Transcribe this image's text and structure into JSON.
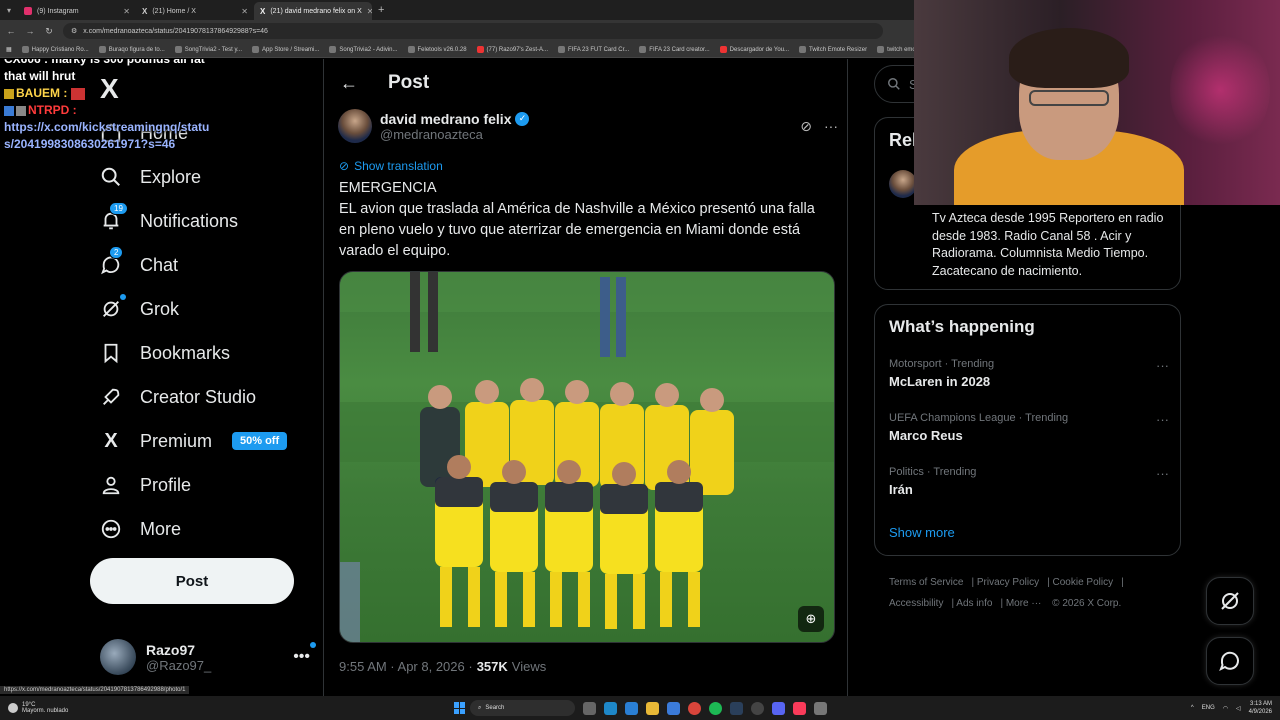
{
  "browser": {
    "tabs": [
      {
        "title": "(9) Instagram",
        "active": false,
        "color": "#e1306c"
      },
      {
        "title": "(21) Home / X",
        "active": false,
        "color": "#ffffff"
      },
      {
        "title": "(21) david medrano felix on X",
        "active": true,
        "color": "#ffffff"
      }
    ],
    "url": "x.com/medranoazteca/status/2041907813786492988?s=46",
    "bookmarks": [
      "Happy Cristiano Ro...",
      "Buraqo figura de to...",
      "SongTrivia2 - Test y...",
      "App Store / Streami...",
      "SongTrivia2 - Adivin...",
      "Feletools v26.0.28",
      "(77) Razo97's Zest-A...",
      "FIFA 23 FUT Card Cr...",
      "FIFA 23 Card creator...",
      "Descargador de You...",
      "Twitch Emote Resizer",
      "twitch emote re..."
    ]
  },
  "chat_overlay": {
    "line1": "CX606 : marky is 300 pounds all fat",
    "line2": "that will hrut",
    "user2": "BAUEM :",
    "user3": "NTRPD :",
    "link": "https://x.com/kickstreamingnq/status/2041998308630261971?s=46"
  },
  "sidebar": {
    "logo": "X",
    "nav": {
      "home": "Home",
      "explore": "Explore",
      "notifications": "Notifications",
      "notifications_badge": "19",
      "chat": "Chat",
      "chat_badge": "2",
      "grok": "Grok",
      "bookmarks": "Bookmarks",
      "creator_studio": "Creator Studio",
      "premium": "Premium",
      "premium_promo": "50% off",
      "profile": "Profile",
      "more": "More"
    },
    "post_button": "Post",
    "account": {
      "name": "Razo97",
      "handle": "@Razo97_",
      "more": "•••"
    }
  },
  "main": {
    "header_title": "Post",
    "author": {
      "name": "david medrano felix",
      "handle": "@medranoazteca"
    },
    "show_translation": "Show translation",
    "text_title": "EMERGENCIA",
    "text_body": "EL avion que traslada al América de Nashville a México presentó una falla en pleno vuelo y tuvo que aterrizar de emergencia en Miami donde está varado el equipo.",
    "time": "9:55 AM · Apr 8, 2026 ·",
    "views_count": "357K",
    "views_label": "Views"
  },
  "right": {
    "search_placeholder": "Se",
    "relevant_title": "Rel",
    "relevant_bio": "Tv Azteca desde 1995 Reportero en radio desde 1983. Radio Canal 58 . Acir y Radiorama. Columnista Medio Tiempo. Zacatecano de nacimiento.",
    "happening_title": "What’s happening",
    "trends": [
      {
        "context": "Motorsport · Trending",
        "name": "McLaren in 2028"
      },
      {
        "context": "UEFA Champions League · Trending",
        "name": "Marco Reus"
      },
      {
        "context": "Politics · Trending",
        "name": "Irán"
      }
    ],
    "show_more": "Show more",
    "footer": {
      "terms": "Terms of Service",
      "privacy": "Privacy Policy",
      "cookie": "Cookie Policy",
      "accessibility": "Accessibility",
      "ads": "Ads info",
      "more": "More ···",
      "copyright": "© 2026 X Corp."
    }
  },
  "status_url": "https://x.com/medranoazteca/status/2041907813786492988/photo/1",
  "taskbar": {
    "temp": "19°C",
    "weather": "Mayorm. nublado",
    "search": "Search",
    "lang": "ENG",
    "time": "3:13 AM",
    "date": "4/9/2026"
  }
}
